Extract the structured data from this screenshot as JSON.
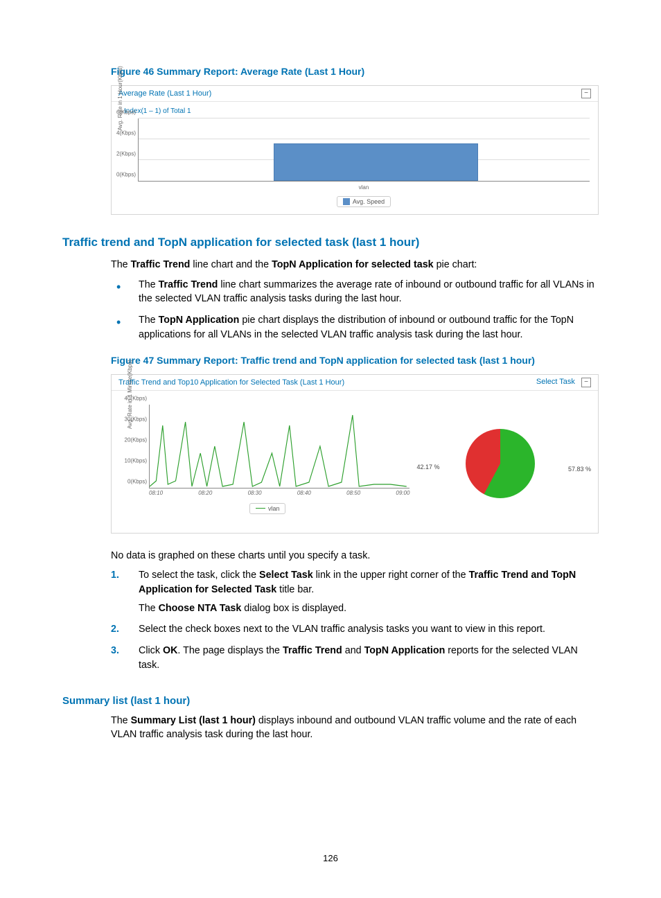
{
  "figure46": {
    "caption": "Figure 46 Summary Report: Average Rate (Last 1 Hour)",
    "panel_title": "Average Rate (Last 1 Hour)",
    "index_label": "Index(1 – 1) of Total 1",
    "y_axis_label": "Avg. Rate in 1 Hour(Kbps)",
    "x_category": "vlan",
    "legend": "Avg. Speed",
    "chart_data": {
      "type": "bar",
      "categories": [
        "vlan"
      ],
      "values": [
        3.5
      ],
      "y_ticks": [
        "0(Kbps)",
        "2(Kbps)",
        "4(Kbps)",
        "6(Kbps)"
      ],
      "ylim": [
        0,
        6
      ]
    }
  },
  "section_traffic": {
    "heading": "Traffic trend and TopN application for selected task (last 1 hour)",
    "intro_pre": "The ",
    "intro_b1": "Traffic Trend",
    "intro_mid1": " line chart and the ",
    "intro_b2": "TopN Application for selected task",
    "intro_post": " pie chart:",
    "bullet1_pre": "The ",
    "bullet1_b": "Traffic Trend",
    "bullet1_post": " line chart summarizes the average rate of inbound or outbound traffic for all VLANs in the selected VLAN traffic analysis tasks during the last hour.",
    "bullet2_pre": "The ",
    "bullet2_b": "TopN Application",
    "bullet2_post": " pie chart displays the distribution of inbound or outbound traffic for the TopN applications for all VLANs in the selected VLAN traffic analysis task during the last hour."
  },
  "figure47": {
    "caption": "Figure 47 Summary Report: Traffic trend and TopN application for selected task (last 1 hour)",
    "panel_title": "Traffic Trend and Top10 Application for Selected Task (Last 1 Hour)",
    "select_task": "Select Task",
    "y_axis_label": "Avg. Rate in 1 Minute(Kbps)",
    "legend": "vlan",
    "pie_label_left": "42.17 %",
    "pie_label_right": "57.83 %",
    "chart_data": [
      {
        "type": "line",
        "series": [
          {
            "name": "vlan",
            "x": [
              "08:10",
              "08:20",
              "08:30",
              "08:40",
              "08:50",
              "09:00"
            ],
            "values_estimate": "spiky series oscillating between ~0 and ~30 Kbps with peaks near 08:12, 08:20, 08:30, 08:40, 08:50"
          }
        ],
        "y_ticks": [
          "0(Kbps)",
          "10(Kbps)",
          "20(Kbps)",
          "30(Kbps)",
          "40(Kbps)"
        ],
        "x_ticks": [
          "08:10",
          "08:20",
          "08:30",
          "08:40",
          "08:50",
          "09:00"
        ],
        "ylim": [
          0,
          40
        ]
      },
      {
        "type": "pie",
        "slices": [
          {
            "label": "42.17 %",
            "value": 42.17,
            "color": "#e03030"
          },
          {
            "label": "57.83 %",
            "value": 57.83,
            "color": "#2bb52b"
          }
        ]
      }
    ]
  },
  "after_fig47": {
    "no_data": "No data is graphed on these charts until you specify a task.",
    "step1_pre": "To select the task, click the ",
    "step1_b1": "Select Task",
    "step1_mid": " link in the upper right corner of the ",
    "step1_b2": "Traffic Trend and TopN Application for Selected Task",
    "step1_post": " title bar.",
    "step1_sub_pre": "The ",
    "step1_sub_b": "Choose NTA Task",
    "step1_sub_post": " dialog box is displayed.",
    "step2": "Select the check boxes next to the VLAN traffic analysis tasks you want to view in this report.",
    "step3_pre": "Click ",
    "step3_b1": "OK",
    "step3_mid1": ". The page displays the ",
    "step3_b2": "Traffic Trend",
    "step3_mid2": " and ",
    "step3_b3": "TopN Application",
    "step3_post": " reports for the selected VLAN task."
  },
  "section_summary": {
    "heading": "Summary list (last 1 hour)",
    "para_pre": "The ",
    "para_b": "Summary List (last 1 hour)",
    "para_post": " displays inbound and outbound VLAN traffic volume and the rate of each VLAN traffic analysis task during the last hour."
  },
  "page_number": "126"
}
